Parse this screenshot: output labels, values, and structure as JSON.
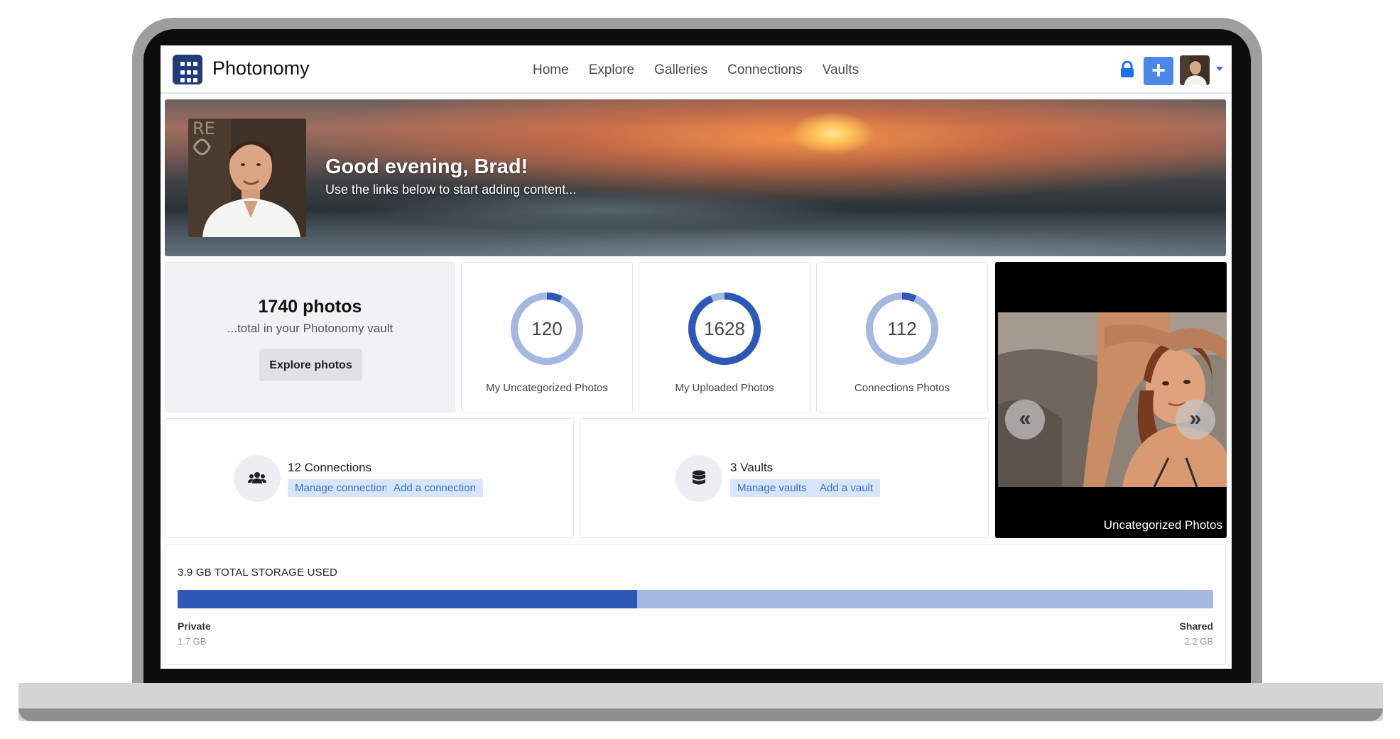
{
  "app": {
    "brand": "Photonomy"
  },
  "nav": {
    "items": [
      "Home",
      "Explore",
      "Galleries",
      "Connections",
      "Vaults"
    ]
  },
  "header_actions": {
    "lock_icon": "lock-icon",
    "add_icon": "plus-icon",
    "add_label": "+"
  },
  "hero": {
    "greeting": "Good evening, Brad!",
    "subtitle": "Use the links below to start adding content..."
  },
  "summary": {
    "total": "1740 photos",
    "total_sub": "...total in your Photonomy vault",
    "explore_label": "Explore photos"
  },
  "stats": [
    {
      "value": "120",
      "label": "My Uncategorized Photos",
      "fraction": 0.07
    },
    {
      "value": "1628",
      "label": "My Uploaded Photos",
      "fraction": 0.935
    },
    {
      "value": "112",
      "label": "Connections Photos",
      "fraction": 0.065
    }
  ],
  "connections": {
    "title": "12 Connections",
    "manage": "Manage connections",
    "add": "Add a connection",
    "icon": "users-icon"
  },
  "vaults": {
    "title": "3 Vaults",
    "manage": "Manage vaults",
    "add": "Add a vault",
    "icon": "database-icon"
  },
  "carousel": {
    "caption": "Uncategorized Photos",
    "prev": "«",
    "next": "»"
  },
  "storage": {
    "title": "3.9 GB TOTAL STORAGE USED",
    "private_label": "Private",
    "private_value": "1.7 GB",
    "shared_label": "Shared",
    "shared_value": "2.2 GB",
    "private_fraction": 0.444
  },
  "colors": {
    "accent": "#2e58b8",
    "accent_light": "#a5b8df",
    "button_blue": "#4b86e8",
    "chip_bg": "#d7e5fb"
  }
}
